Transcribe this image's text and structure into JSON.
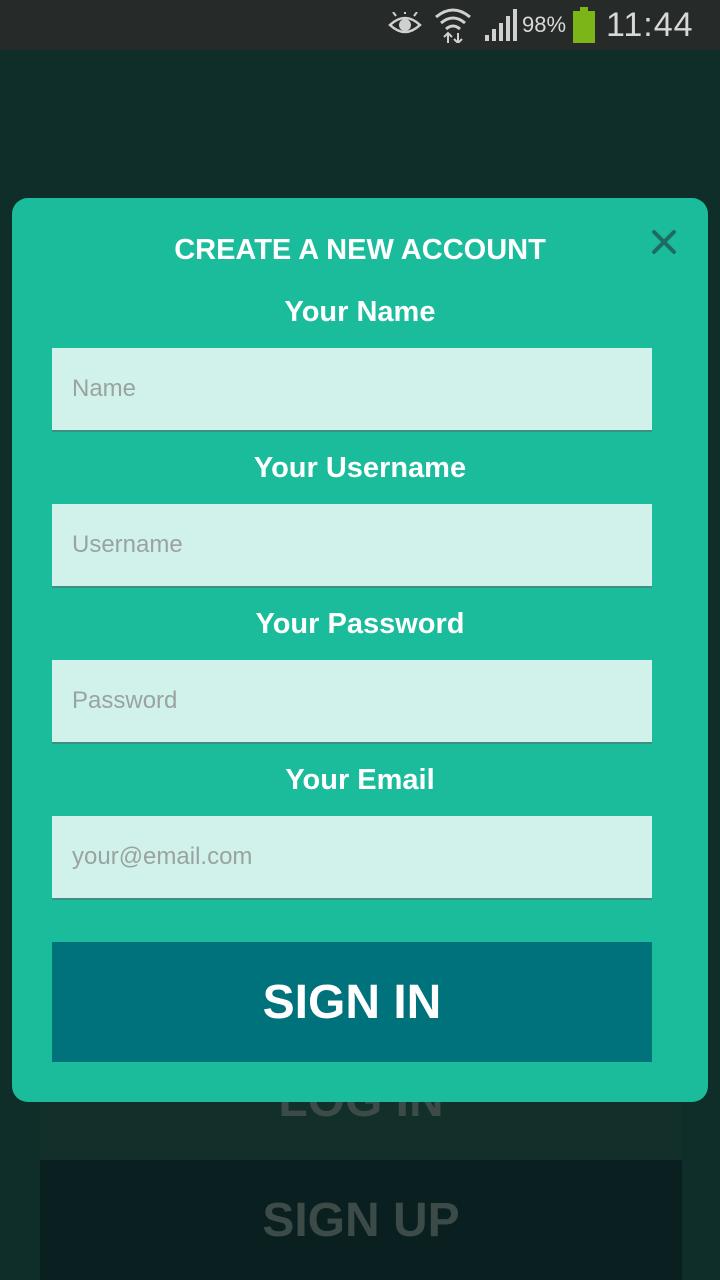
{
  "status_bar": {
    "battery_percent": "98%",
    "time": "11:44",
    "icons": [
      "eye-icon",
      "wifi-icon",
      "signal-icon",
      "battery-icon"
    ],
    "battery_color": "#7cb518"
  },
  "background": {
    "login_label": "LOG IN",
    "signup_label": "SIGN UP"
  },
  "modal": {
    "title": "CREATE A NEW ACCOUNT",
    "close_icon": "close-icon",
    "fields": [
      {
        "label": "Your Name",
        "placeholder": "Name",
        "value": ""
      },
      {
        "label": "Your Username",
        "placeholder": "Username",
        "value": ""
      },
      {
        "label": "Your Password",
        "placeholder": "Password",
        "value": ""
      },
      {
        "label": "Your Email",
        "placeholder": "your@email.com",
        "value": ""
      }
    ],
    "submit_label": "SIGN IN"
  },
  "colors": {
    "modal_bg": "#1bbc9b",
    "field_bg": "#d1f2eb",
    "submit_bg": "#00727b"
  }
}
